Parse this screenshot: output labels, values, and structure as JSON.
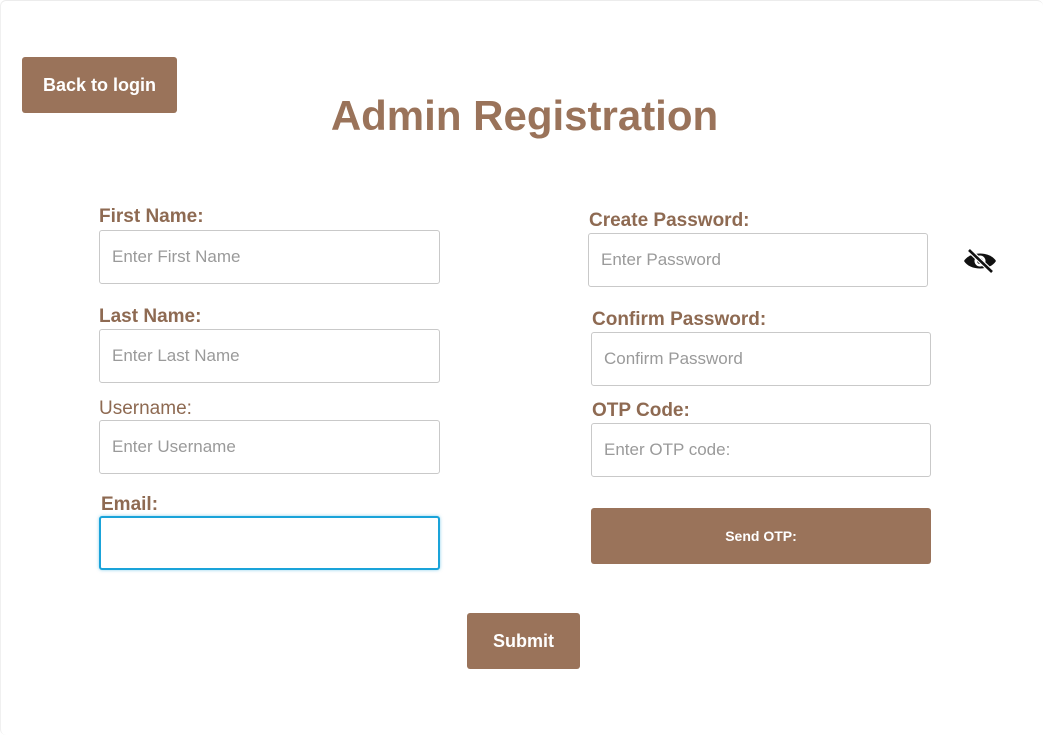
{
  "header": {
    "back_label": "Back to login",
    "title": "Admin Registration"
  },
  "form": {
    "first_name": {
      "label": "First Name:",
      "placeholder": "Enter First Name",
      "value": ""
    },
    "last_name": {
      "label": "Last Name:",
      "placeholder": "Enter Last Name",
      "value": ""
    },
    "username": {
      "label": "Username:",
      "placeholder": "Enter Username",
      "value": ""
    },
    "email": {
      "label": "Email:",
      "placeholder": "",
      "value": ""
    },
    "create_password": {
      "label": "Create Password:",
      "placeholder": "Enter Password",
      "value": ""
    },
    "confirm_password": {
      "label": "Confirm Password:",
      "placeholder": "Confirm Password",
      "value": ""
    },
    "otp_code": {
      "label": "OTP Code:",
      "placeholder": "Enter OTP code:",
      "value": ""
    },
    "send_otp_label": "Send OTP:",
    "submit_label": "Submit"
  },
  "icons": {
    "password_toggle": "eye-slash-icon"
  },
  "colors": {
    "accent": "#9a735a",
    "label": "#8e6a52",
    "focus": "#1aa3d9"
  }
}
